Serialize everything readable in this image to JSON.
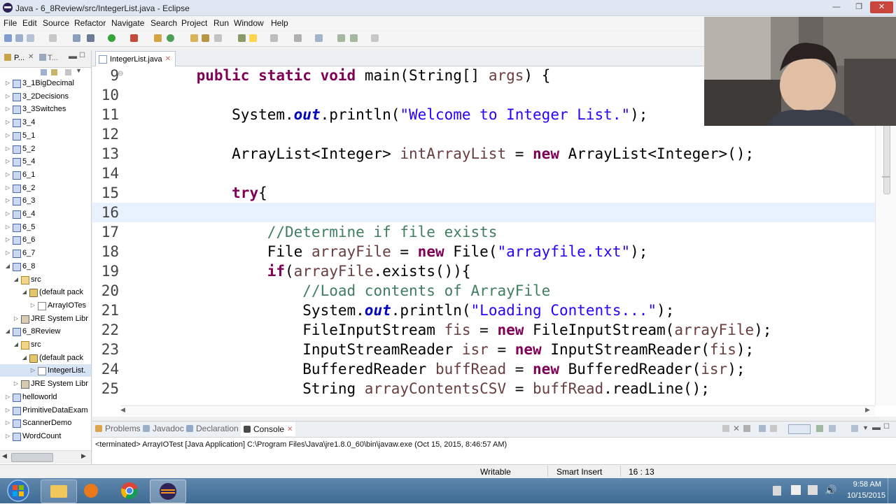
{
  "window": {
    "title": "Java - 6_8Review/src/IntegerList.java - Eclipse"
  },
  "menu": [
    "File",
    "Edit",
    "Source",
    "Refactor",
    "Navigate",
    "Search",
    "Project",
    "Run",
    "Window",
    "Help"
  ],
  "left_panel": {
    "tab1": "P...",
    "tab2": "T...",
    "tree": [
      {
        "label": "3_1BigDecimal",
        "level": 0,
        "twisty": "▷",
        "icon": "project-icon"
      },
      {
        "label": "3_2Decisions",
        "level": 0,
        "twisty": "▷",
        "icon": "project-icon"
      },
      {
        "label": "3_3Switches",
        "level": 0,
        "twisty": "▷",
        "icon": "project-icon"
      },
      {
        "label": "3_4",
        "level": 0,
        "twisty": "▷",
        "icon": "project-icon"
      },
      {
        "label": "5_1",
        "level": 0,
        "twisty": "▷",
        "icon": "project-icon"
      },
      {
        "label": "5_2",
        "level": 0,
        "twisty": "▷",
        "icon": "project-icon"
      },
      {
        "label": "5_4",
        "level": 0,
        "twisty": "▷",
        "icon": "project-icon"
      },
      {
        "label": "6_1",
        "level": 0,
        "twisty": "▷",
        "icon": "project-icon"
      },
      {
        "label": "6_2",
        "level": 0,
        "twisty": "▷",
        "icon": "project-icon"
      },
      {
        "label": "6_3",
        "level": 0,
        "twisty": "▷",
        "icon": "project-icon"
      },
      {
        "label": "6_4",
        "level": 0,
        "twisty": "▷",
        "icon": "project-icon"
      },
      {
        "label": "6_5",
        "level": 0,
        "twisty": "▷",
        "icon": "project-icon"
      },
      {
        "label": "6_6",
        "level": 0,
        "twisty": "▷",
        "icon": "project-icon"
      },
      {
        "label": "6_7",
        "level": 0,
        "twisty": "▷",
        "icon": "project-icon"
      },
      {
        "label": "6_8",
        "level": 0,
        "twisty": "◢",
        "icon": "project-icon"
      },
      {
        "label": "src",
        "level": 1,
        "twisty": "◢",
        "icon": "source-folder-icon"
      },
      {
        "label": "(default pack",
        "level": 2,
        "twisty": "◢",
        "icon": "package-icon"
      },
      {
        "label": "ArrayIOTes",
        "level": 3,
        "twisty": "▷",
        "icon": "java-file-icon"
      },
      {
        "label": "JRE System Libr",
        "level": 1,
        "twisty": "▷",
        "icon": "library-icon"
      },
      {
        "label": "6_8Review",
        "level": 0,
        "twisty": "◢",
        "icon": "project-icon"
      },
      {
        "label": "src",
        "level": 1,
        "twisty": "◢",
        "icon": "source-folder-icon"
      },
      {
        "label": "(default pack",
        "level": 2,
        "twisty": "◢",
        "icon": "package-icon"
      },
      {
        "label": "IntegerList.",
        "level": 3,
        "twisty": "▷",
        "icon": "java-file-icon",
        "selected": true
      },
      {
        "label": "JRE System Libr",
        "level": 1,
        "twisty": "▷",
        "icon": "library-icon"
      },
      {
        "label": "helloworld",
        "level": 0,
        "twisty": "▷",
        "icon": "project-icon"
      },
      {
        "label": "PrimitiveDataExam",
        "level": 0,
        "twisty": "▷",
        "icon": "project-icon"
      },
      {
        "label": "ScannerDemo",
        "level": 0,
        "twisty": "▷",
        "icon": "project-icon"
      },
      {
        "label": "WordCount",
        "level": 0,
        "twisty": "▷",
        "icon": "project-icon"
      }
    ]
  },
  "editor": {
    "tab_label": "IntegerList.java",
    "current_line": 16,
    "lines": [
      {
        "n": "9",
        "tokens": [
          [
            "    ",
            ""
          ],
          [
            "public",
            "kw"
          ],
          [
            " ",
            ""
          ],
          [
            "static",
            "kw"
          ],
          [
            " ",
            ""
          ],
          [
            "void",
            "kw"
          ],
          [
            " main(String[] ",
            ""
          ],
          [
            "args",
            "vr"
          ],
          [
            ") {",
            ""
          ]
        ]
      },
      {
        "n": "10",
        "tokens": []
      },
      {
        "n": "11",
        "tokens": [
          [
            "        System.",
            ""
          ],
          [
            "out",
            "fd"
          ],
          [
            ".println(",
            ""
          ],
          [
            "\"Welcome to Integer List.\"",
            "st"
          ],
          [
            ");",
            ""
          ]
        ]
      },
      {
        "n": "12",
        "tokens": []
      },
      {
        "n": "13",
        "tokens": [
          [
            "        ArrayList<Integer> ",
            ""
          ],
          [
            "intArrayList",
            "vr"
          ],
          [
            " = ",
            ""
          ],
          [
            "new",
            "kw"
          ],
          [
            " ArrayList<Integer>();",
            ""
          ]
        ]
      },
      {
        "n": "14",
        "tokens": []
      },
      {
        "n": "15",
        "tokens": [
          [
            "        ",
            ""
          ],
          [
            "try",
            "kw"
          ],
          [
            "{",
            ""
          ]
        ]
      },
      {
        "n": "16",
        "tokens": []
      },
      {
        "n": "17",
        "tokens": [
          [
            "            ",
            ""
          ],
          [
            "//Determine if file exists",
            "cm"
          ]
        ]
      },
      {
        "n": "18",
        "tokens": [
          [
            "            File ",
            ""
          ],
          [
            "arrayFile",
            "vr"
          ],
          [
            " = ",
            ""
          ],
          [
            "new",
            "kw"
          ],
          [
            " File(",
            ""
          ],
          [
            "\"arrayfile.txt\"",
            "st"
          ],
          [
            ");",
            ""
          ]
        ]
      },
      {
        "n": "19",
        "tokens": [
          [
            "            ",
            ""
          ],
          [
            "if",
            "kw"
          ],
          [
            "(",
            ""
          ],
          [
            "arrayFile",
            "vr"
          ],
          [
            ".exists()){",
            ""
          ]
        ]
      },
      {
        "n": "20",
        "tokens": [
          [
            "                ",
            ""
          ],
          [
            "//Load contents of ArrayFile",
            "cm"
          ]
        ]
      },
      {
        "n": "21",
        "tokens": [
          [
            "                System.",
            ""
          ],
          [
            "out",
            "fd"
          ],
          [
            ".println(",
            ""
          ],
          [
            "\"Loading Contents...\"",
            "st"
          ],
          [
            ");",
            ""
          ]
        ]
      },
      {
        "n": "22",
        "tokens": [
          [
            "                FileInputStream ",
            ""
          ],
          [
            "fis",
            "vr"
          ],
          [
            " = ",
            ""
          ],
          [
            "new",
            "kw"
          ],
          [
            " FileInputStream(",
            ""
          ],
          [
            "arrayFile",
            "vr"
          ],
          [
            ");",
            ""
          ]
        ]
      },
      {
        "n": "23",
        "tokens": [
          [
            "                InputStreamReader ",
            ""
          ],
          [
            "isr",
            "vr"
          ],
          [
            " = ",
            ""
          ],
          [
            "new",
            "kw"
          ],
          [
            " InputStreamReader(",
            ""
          ],
          [
            "fis",
            "vr"
          ],
          [
            ");",
            ""
          ]
        ]
      },
      {
        "n": "24",
        "tokens": [
          [
            "                BufferedReader ",
            ""
          ],
          [
            "buffRead",
            "vr"
          ],
          [
            " = ",
            ""
          ],
          [
            "new",
            "kw"
          ],
          [
            " BufferedReader(",
            ""
          ],
          [
            "isr",
            "vr"
          ],
          [
            ");",
            ""
          ]
        ]
      },
      {
        "n": "25",
        "tokens": [
          [
            "                String ",
            ""
          ],
          [
            "arrayContentsCSV",
            "vr"
          ],
          [
            " = ",
            ""
          ],
          [
            "buffRead",
            "vr"
          ],
          [
            ".readLine();",
            ""
          ]
        ]
      }
    ]
  },
  "console": {
    "tabs": [
      "Problems",
      "Javadoc",
      "Declaration",
      "Console"
    ],
    "active_tab": "Console",
    "text": "<terminated> ArrayIOTest [Java Application] C:\\Program Files\\Java\\jre1.8.0_60\\bin\\javaw.exe (Oct 15, 2015, 8:46:57 AM)"
  },
  "status": {
    "writable": "Writable",
    "insert_mode": "Smart Insert",
    "position": "16 : 13"
  },
  "taskbar": {
    "time": "9:58 AM",
    "date": "10/15/2015"
  }
}
